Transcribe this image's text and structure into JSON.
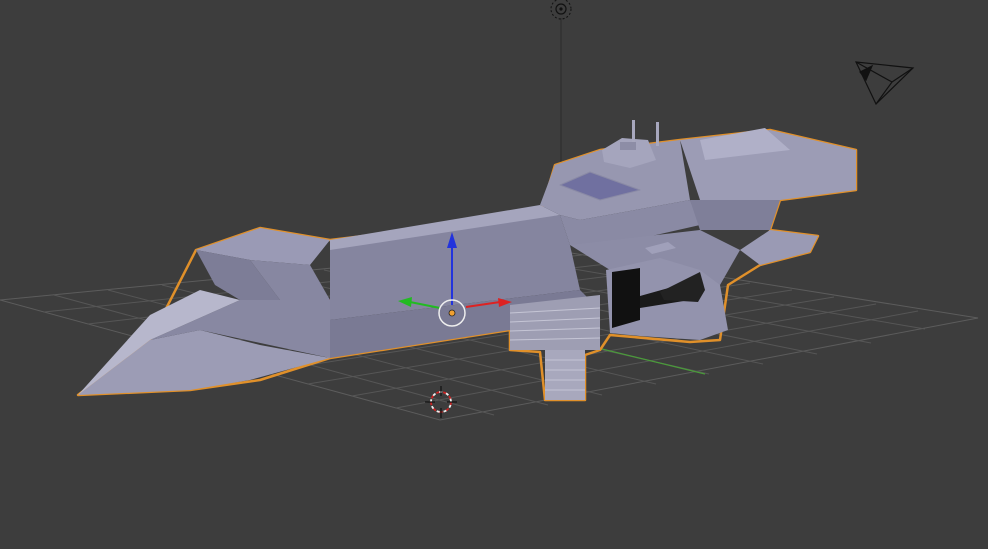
{
  "viewport": {
    "mode": "3d-viewport",
    "background_color": "#3d3d3d",
    "grid_color": "#5a5a5a",
    "x_axis_color": "#c83232",
    "y_axis_color": "#4a9a3a",
    "selection_outline_color": "#e0902a"
  },
  "scene_objects": [
    {
      "name": "spaceship-mesh",
      "selected": true,
      "body_color": "#8e8ea8"
    },
    {
      "name": "camera",
      "icon": "camera-icon"
    },
    {
      "name": "lamp",
      "icon": "lamp-icon"
    },
    {
      "name": "3d-cursor",
      "icon": "3d-cursor-icon"
    }
  ],
  "manipulator": {
    "z_arrow_color": "#2233dd",
    "y_arrow_color": "#22bb22",
    "x_arrow_color": "#dd2222"
  }
}
